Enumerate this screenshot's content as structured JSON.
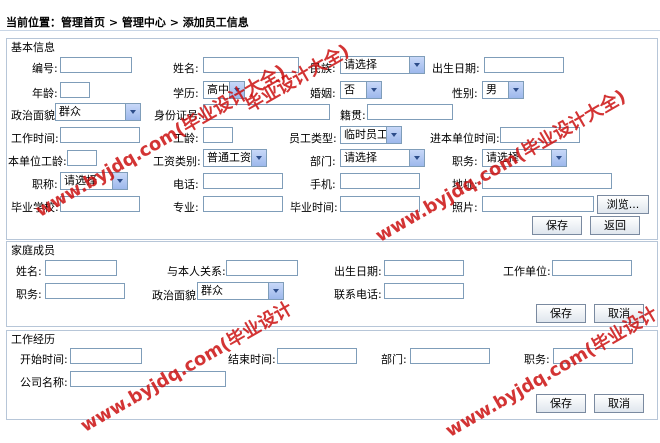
{
  "breadcrumb": {
    "text": "当前位置：管理首页 > 管理中心 > 添加员工信息"
  },
  "basic": {
    "title": "基本信息",
    "labels": {
      "id": "编号:",
      "name": "姓名:",
      "ethnicity": "民族:",
      "birth": "出生日期:",
      "age": "年龄:",
      "education": "学历:",
      "marital": "婚姻:",
      "gender": "性别:",
      "political": "政治面貌:",
      "idcard": "身份证号:",
      "native": "籍贯:",
      "worktime": "工作时间:",
      "workyears": "工龄:",
      "emptype": "员工类型:",
      "jointime": "进本单位时间:",
      "unityears": "本单位工龄:",
      "salarytype": "工资类别:",
      "dept": "部门:",
      "position": "职务:",
      "title": "职称:",
      "phone": "电话:",
      "mobile": "手机:",
      "address": "地址:",
      "school": "毕业学校:",
      "major": "专业:",
      "gradtime": "毕业时间:",
      "photo": "照片:"
    },
    "values": {
      "ethnicity": "请选择",
      "education": "高中",
      "marital": "否",
      "gender": "男",
      "political": "群众",
      "emptype": "临时员工",
      "salarytype": "普通工资",
      "dept": "请选择",
      "position": "请选择",
      "title": "请选择"
    },
    "browse_label": "浏览...",
    "save_label": "保存",
    "back_label": "返回"
  },
  "family": {
    "title": "家庭成员",
    "labels": {
      "name": "姓名:",
      "relation": "与本人关系:",
      "birth": "出生日期:",
      "workunit": "工作单位:",
      "position": "职务:",
      "political": "政治面貌:",
      "phone": "联系电话:"
    },
    "values": {
      "political": "群众"
    },
    "save_label": "保存",
    "cancel_label": "取消"
  },
  "work": {
    "title": "工作经历",
    "labels": {
      "start": "开始时间:",
      "end": "结束时间:",
      "dept": "部门:",
      "position": "职务:",
      "company": "公司名称:"
    },
    "save_label": "保存",
    "cancel_label": "取消"
  },
  "watermark": {
    "a": "www.byjdq.com(毕业设计大全)",
    "b": "毕业设计大全)",
    "c": "www.byjdq.com(毕业设计"
  }
}
